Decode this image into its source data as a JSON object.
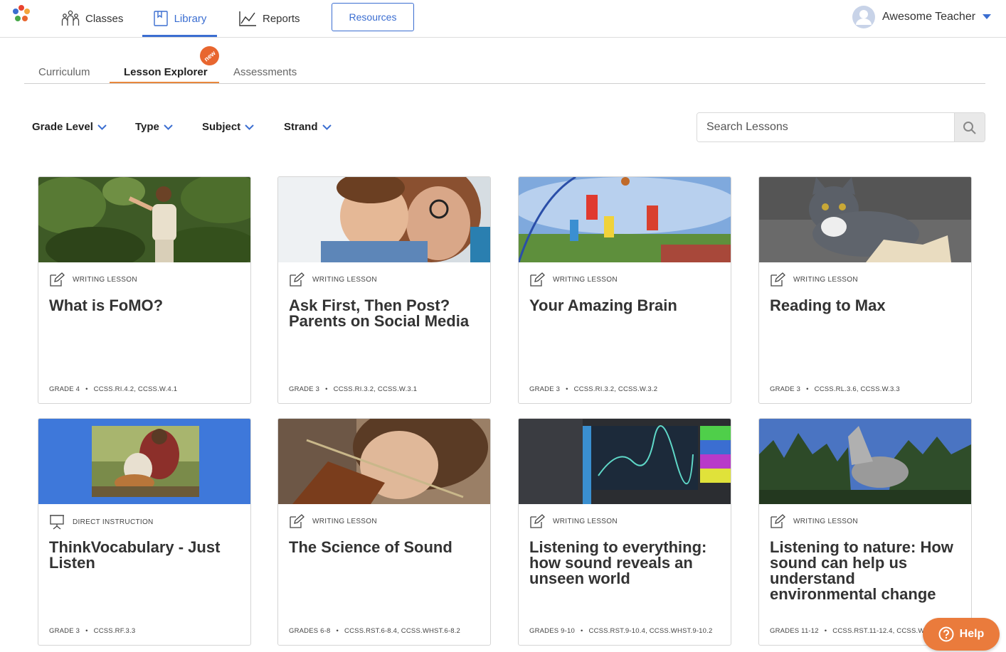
{
  "nav": {
    "classes_label": "Classes",
    "library_label": "Library",
    "reports_label": "Reports",
    "resources_label": "Resources",
    "user_name": "Awesome Teacher",
    "accent_color": "#3b6ed1"
  },
  "subtabs": {
    "curriculum": "Curriculum",
    "lesson_explorer": "Lesson Explorer",
    "assessments": "Assessments",
    "new_badge": "new",
    "active": "Lesson Explorer"
  },
  "filters": {
    "grade_level": "Grade Level",
    "type": "Type",
    "subject": "Subject",
    "strand": "Strand"
  },
  "search": {
    "placeholder": "Search Lessons"
  },
  "cards": [
    {
      "type": "WRITING LESSON",
      "title": "What is FoMO?",
      "grade": "GRADE 4",
      "standards": "CCSS.RI.4.2, CCSS.W.4.1",
      "icon": "pencil-icon"
    },
    {
      "type": "WRITING LESSON",
      "title": "Ask First, Then Post? Parents on Social Media",
      "grade": "GRADE 3",
      "standards": "CCSS.RI.3.2, CCSS.W.3.1",
      "icon": "pencil-icon"
    },
    {
      "type": "WRITING LESSON",
      "title": "Your Amazing Brain",
      "grade": "GRADE 3",
      "standards": "CCSS.RI.3.2, CCSS.W.3.2",
      "icon": "pencil-icon"
    },
    {
      "type": "WRITING LESSON",
      "title": "Reading to Max",
      "grade": "GRADE 3",
      "standards": "CCSS.RL.3.6, CCSS.W.3.3",
      "icon": "pencil-icon"
    },
    {
      "type": "DIRECT INSTRUCTION",
      "title": "ThinkVocabulary - Just Listen",
      "grade": "GRADE 3",
      "standards": "CCSS.RF.3.3",
      "icon": "presentation-icon"
    },
    {
      "type": "WRITING LESSON",
      "title": "The Science of Sound",
      "grade": "GRADES 6-8",
      "standards": "CCSS.RST.6-8.4, CCSS.WHST.6-8.2",
      "icon": "pencil-icon"
    },
    {
      "type": "WRITING LESSON",
      "title": "Listening to everything: how sound reveals an unseen world",
      "grade": "GRADES 9-10",
      "standards": "CCSS.RST.9-10.4, CCSS.WHST.9-10.2",
      "icon": "pencil-icon"
    },
    {
      "type": "WRITING LESSON",
      "title": "Listening to nature: How sound can help us understand environmental change",
      "grade": "GRADES 11-12",
      "standards": "CCSS.RST.11-12.4, CCSS.WHST.11-12.2",
      "icon": "pencil-icon"
    }
  ],
  "help": {
    "label": "Help",
    "color": "#ea7b3c"
  }
}
